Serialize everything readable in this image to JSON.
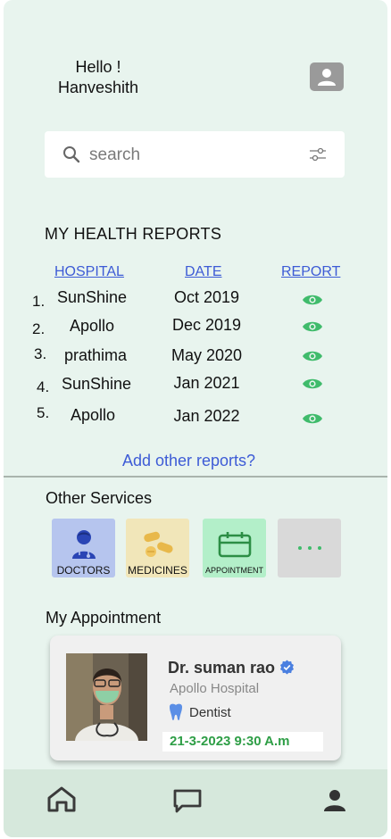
{
  "header": {
    "greeting_line1": "Hello !",
    "greeting_line2": "Hanveshith",
    "profile_icon": "user-icon"
  },
  "search": {
    "placeholder": "search",
    "search_icon": "search-icon",
    "filter_icon": "sliders-icon"
  },
  "reports": {
    "title": "MY HEALTH REPORTS",
    "columns": {
      "hospital": "HOSPITAL",
      "date": "DATE",
      "report": "REPORT"
    },
    "rows": [
      {
        "num": "1.",
        "hospital": "SunShine",
        "date": "Oct 2019"
      },
      {
        "num": "2.",
        "hospital": "Apollo",
        "date": "Dec 2019"
      },
      {
        "num": "3.",
        "hospital": "prathima",
        "date": "May 2020"
      },
      {
        "num": "4.",
        "hospital": "SunShine",
        "date": "Jan 2021"
      },
      {
        "num": "5.",
        "hospital": "Apollo",
        "date": "Jan 2022"
      }
    ],
    "add_link": "Add other reports?"
  },
  "services": {
    "title": "Other Services",
    "items": [
      {
        "label": "DOCTORS",
        "icon": "doctor-icon",
        "color": "#b6c5ee"
      },
      {
        "label": "MEDICINES",
        "icon": "pills-icon",
        "color": "#f1e6b9"
      },
      {
        "label": "APPOINTMENT",
        "icon": "calendar-icon",
        "color": "#b3efc9"
      },
      {
        "label": "",
        "icon": "more-icon",
        "color": "#d9d9d9"
      }
    ]
  },
  "appointment": {
    "title": "My Appointment",
    "doctor": "Dr. suman rao",
    "hospital": "Apollo Hospital",
    "specialty": "Dentist",
    "datetime": "21-3-2023 9:30 A.m"
  },
  "nav": {
    "items": [
      "home-icon",
      "chat-icon",
      "profile-icon"
    ]
  },
  "colors": {
    "background": "#e8f4ee",
    "link": "#3d5bd6",
    "accent_green": "#2e9e46",
    "bottom_nav": "#d6e8dc"
  }
}
